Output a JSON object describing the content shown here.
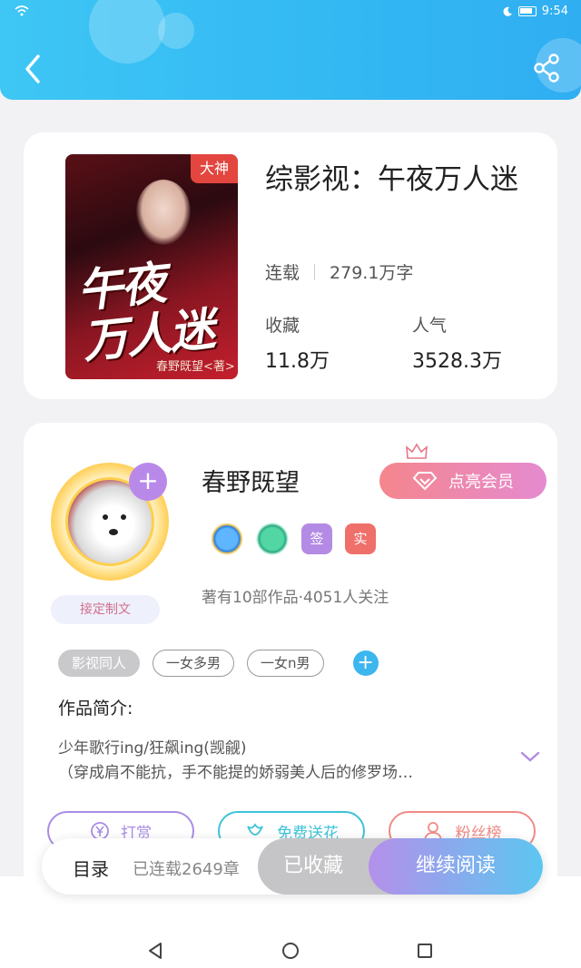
{
  "status_bar": {
    "time": "9:54"
  },
  "book": {
    "cover_badge": "大神",
    "cover_title_line1": "午夜",
    "cover_title_line2": "万人迷",
    "cover_author": "春野既望<著>",
    "title": "综影视：午夜万人迷",
    "status": "连载",
    "word_count": "279.1万字",
    "collect_label": "收藏",
    "collect_value": "11.8万",
    "popularity_label": "人气",
    "popularity_value": "3528.3万"
  },
  "author": {
    "name": "春野既望",
    "custom_tag": "接定制文",
    "vip_button": "点亮会员",
    "badge_sign": "签",
    "badge_real": "实",
    "works_info": "著有10部作品·4051人关注"
  },
  "tags": [
    "影视同人",
    "一女多男",
    "一女n男"
  ],
  "intro": {
    "label": "作品简介:",
    "line1": "少年歌行ing/狂飙ing(觊觎)",
    "line2": "（穿成肩不能抗，手不能提的娇弱美人后的修罗场…"
  },
  "actions": {
    "tip": "打赏",
    "flower": "免费送花",
    "fans": "粉丝榜"
  },
  "bottom_bar": {
    "toc": "目录",
    "chapter_info": "已连载2649章",
    "collected": "已收藏",
    "continue_reading": "继续阅读"
  },
  "colors": {
    "header": "#33b8f3",
    "accent_purple": "#b989ea",
    "accent_blue": "#3cb6ee",
    "vip_pink": "#f5868d",
    "tip_purple": "#a88ce6",
    "flower_teal": "#3cc3d8",
    "fans_red": "#ef8a86"
  }
}
